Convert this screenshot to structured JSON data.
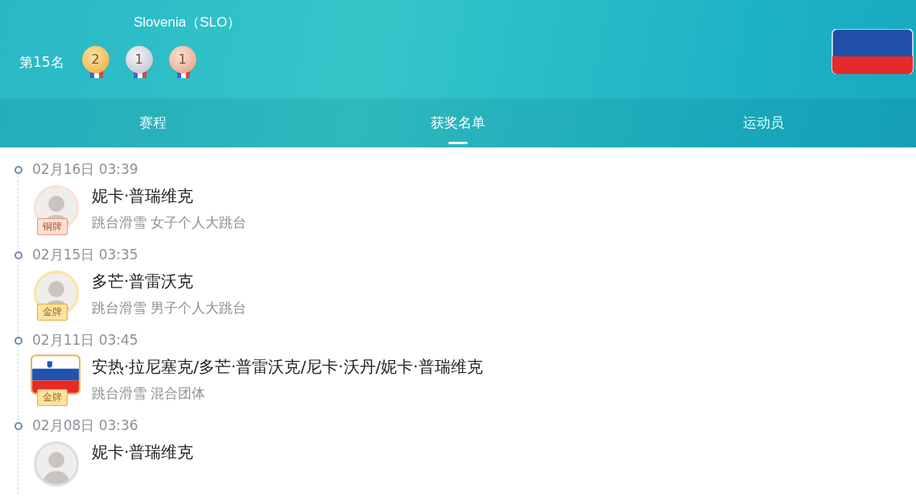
{
  "header": {
    "country": "Slovenia（SLO）",
    "rank": "第15名",
    "medals": [
      {
        "kind": "gold",
        "count": "2"
      },
      {
        "kind": "silver",
        "count": "1"
      },
      {
        "kind": "bronze",
        "count": "1"
      }
    ]
  },
  "tabs": [
    {
      "label": "赛程",
      "selected": false
    },
    {
      "label": "获奖名单",
      "selected": true
    },
    {
      "label": "运动员",
      "selected": false
    }
  ],
  "entries": [
    {
      "time": "02月16日 03:39",
      "kind": "person",
      "medal": {
        "kind": "bronze",
        "label": "铜牌"
      },
      "name": "妮卡·普瑞维克",
      "event": "跳台滑雪 女子个人大跳台"
    },
    {
      "time": "02月15日 03:35",
      "kind": "person",
      "medal": {
        "kind": "gold",
        "label": "金牌"
      },
      "name": "多芒·普雷沃克",
      "event": "跳台滑雪 男子个人大跳台"
    },
    {
      "time": "02月11日 03:45",
      "kind": "team",
      "medal": {
        "kind": "gold",
        "label": "金牌"
      },
      "name": "安热·拉尼塞克/多芒·普雷沃克/尼卡·沃丹/妮卡·普瑞维克",
      "event": "跳台滑雪 混合团体"
    },
    {
      "time": "02月08日 03:36",
      "kind": "person",
      "name": "妮卡·普瑞维克"
    }
  ]
}
